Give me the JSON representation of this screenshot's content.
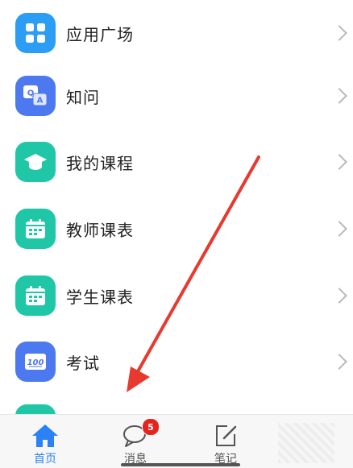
{
  "menu": {
    "items": [
      {
        "label": "应用广场",
        "icon": "grid-icon",
        "color": "#2b9df4"
      },
      {
        "label": "知问",
        "icon": "qa-icon",
        "color": "#4d79f0"
      },
      {
        "label": "我的课程",
        "icon": "graduation-cap-icon",
        "color": "#1fc7a7"
      },
      {
        "label": "教师课表",
        "icon": "calendar-icon",
        "color": "#1fc7a7"
      },
      {
        "label": "学生课表",
        "icon": "calendar-icon",
        "color": "#1fc7a7"
      },
      {
        "label": "考试",
        "icon": "exam-score-icon",
        "color": "#4d79f0"
      }
    ]
  },
  "qa_icon_text": {
    "q": "Q",
    "a": "A"
  },
  "exam_icon_text": "100",
  "tabbar": {
    "tabs": [
      {
        "label": "首页",
        "icon": "home-icon",
        "active": true
      },
      {
        "label": "消息",
        "icon": "message-icon",
        "active": false
      },
      {
        "label": "笔记",
        "icon": "note-edit-icon",
        "active": false
      }
    ],
    "message_badge": "5"
  },
  "colors": {
    "accent": "#2b82f6",
    "arrow": "#e8392f",
    "badge": "#e8231d"
  }
}
